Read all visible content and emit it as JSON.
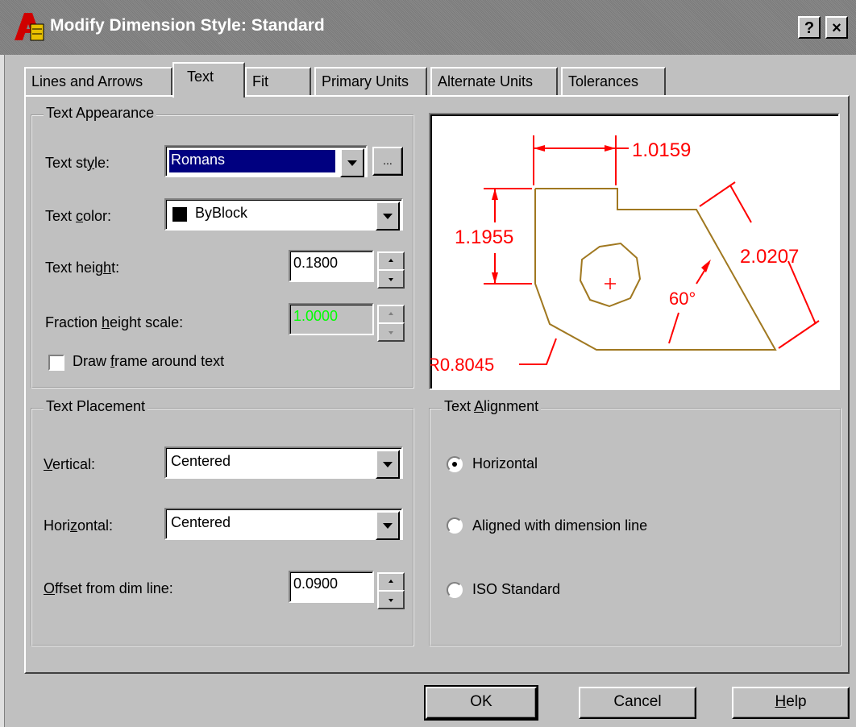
{
  "window": {
    "title": "Modify Dimension Style: Standard",
    "help_button": "?",
    "close_button": "×"
  },
  "tabs": [
    {
      "label": "Lines and Arrows",
      "active": false
    },
    {
      "label": "Text",
      "active": true
    },
    {
      "label": "Fit",
      "active": false
    },
    {
      "label": "Primary Units",
      "active": false
    },
    {
      "label": "Alternate Units",
      "active": false
    },
    {
      "label": "Tolerances",
      "active": false
    }
  ],
  "text_appearance": {
    "group_title": "Text Appearance",
    "text_style": {
      "label_pre": "Text st",
      "label_key": "y",
      "label_post": "le:",
      "value": "Romans",
      "browse_button": "..."
    },
    "text_color": {
      "label_pre": "Text ",
      "label_key": "c",
      "label_post": "olor:",
      "value": "ByBlock",
      "swatch_color": "#000000"
    },
    "text_height": {
      "label_pre": "Text heig",
      "label_key": "h",
      "label_post": "t:",
      "value": "0.1800"
    },
    "fraction_height_scale": {
      "label_pre": "Fraction ",
      "label_key": "h",
      "label_post": "eight scale:",
      "value": "1.0000",
      "value_color": "#00ff00",
      "enabled": false
    },
    "draw_frame": {
      "label_pre": "Draw ",
      "label_key": "f",
      "label_post": "rame around text",
      "checked": false
    }
  },
  "preview": {
    "dim_top": "1.0159",
    "dim_left": "1.1955",
    "dim_right": "2.0207",
    "angle": "60°",
    "radius": "R0.8045",
    "dim_color": "#ff0000",
    "part_color": "#a07820"
  },
  "text_placement": {
    "group_title": "Text Placement",
    "vertical": {
      "label_pre": "",
      "label_key": "V",
      "label_post": "ertical:",
      "value": "Centered"
    },
    "horizontal": {
      "label_pre": "Hori",
      "label_key": "z",
      "label_post": "ontal:",
      "value": "Centered"
    },
    "offset": {
      "label_pre": "",
      "label_key": "O",
      "label_post": "ffset from dim line:",
      "value": "0.0900"
    }
  },
  "text_alignment": {
    "group_title_pre": "Text ",
    "group_title_key": "A",
    "group_title_post": "lignment",
    "options": [
      {
        "label": "Horizontal",
        "selected": true
      },
      {
        "label": "Aligned with dimension line",
        "selected": false
      },
      {
        "label": "ISO Standard",
        "selected": false
      }
    ]
  },
  "footer": {
    "ok": "OK",
    "cancel": "Cancel",
    "help_pre": "",
    "help_key": "H",
    "help_post": "elp"
  }
}
